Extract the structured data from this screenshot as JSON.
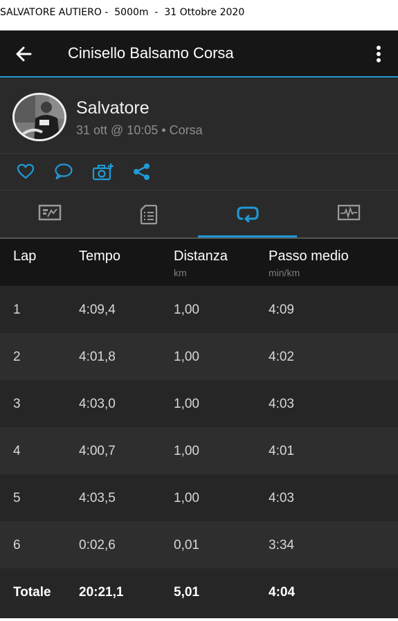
{
  "caption": "SALVATORE AUTIERO -  5000m  -  31 Ottobre 2020",
  "appbar": {
    "title": "Cinisello Balsamo Corsa",
    "back_icon": "arrow-left-icon",
    "menu_icon": "more-vertical-icon"
  },
  "profile": {
    "name": "Salvatore",
    "meta": "31 ott @ 10:05 • Corsa"
  },
  "social_icons": [
    "heart-icon",
    "comment-icon",
    "add-photo-icon",
    "share-icon"
  ],
  "tabs": [
    {
      "icon": "stats-icon",
      "active": false
    },
    {
      "icon": "details-icon",
      "active": false
    },
    {
      "icon": "laps-icon",
      "active": true
    },
    {
      "icon": "graph-icon",
      "active": false
    }
  ],
  "colors": {
    "accent": "#1f9bd7",
    "background": "#262626",
    "header": "#151515"
  },
  "table": {
    "headers": {
      "lap": "Lap",
      "tempo": "Tempo",
      "distanza": "Distanza",
      "distanza_unit": "km",
      "passo": "Passo medio",
      "passo_unit": "min/km"
    },
    "rows": [
      {
        "lap": "1",
        "tempo": "4:09,4",
        "distanza": "1,00",
        "passo": "4:09"
      },
      {
        "lap": "2",
        "tempo": "4:01,8",
        "distanza": "1,00",
        "passo": "4:02"
      },
      {
        "lap": "3",
        "tempo": "4:03,0",
        "distanza": "1,00",
        "passo": "4:03"
      },
      {
        "lap": "4",
        "tempo": "4:00,7",
        "distanza": "1,00",
        "passo": "4:01"
      },
      {
        "lap": "5",
        "tempo": "4:03,5",
        "distanza": "1,00",
        "passo": "4:03"
      },
      {
        "lap": "6",
        "tempo": "0:02,6",
        "distanza": "0,01",
        "passo": "3:34"
      }
    ],
    "total": {
      "lap": "Totale",
      "tempo": "20:21,1",
      "distanza": "5,01",
      "passo": "4:04"
    }
  }
}
